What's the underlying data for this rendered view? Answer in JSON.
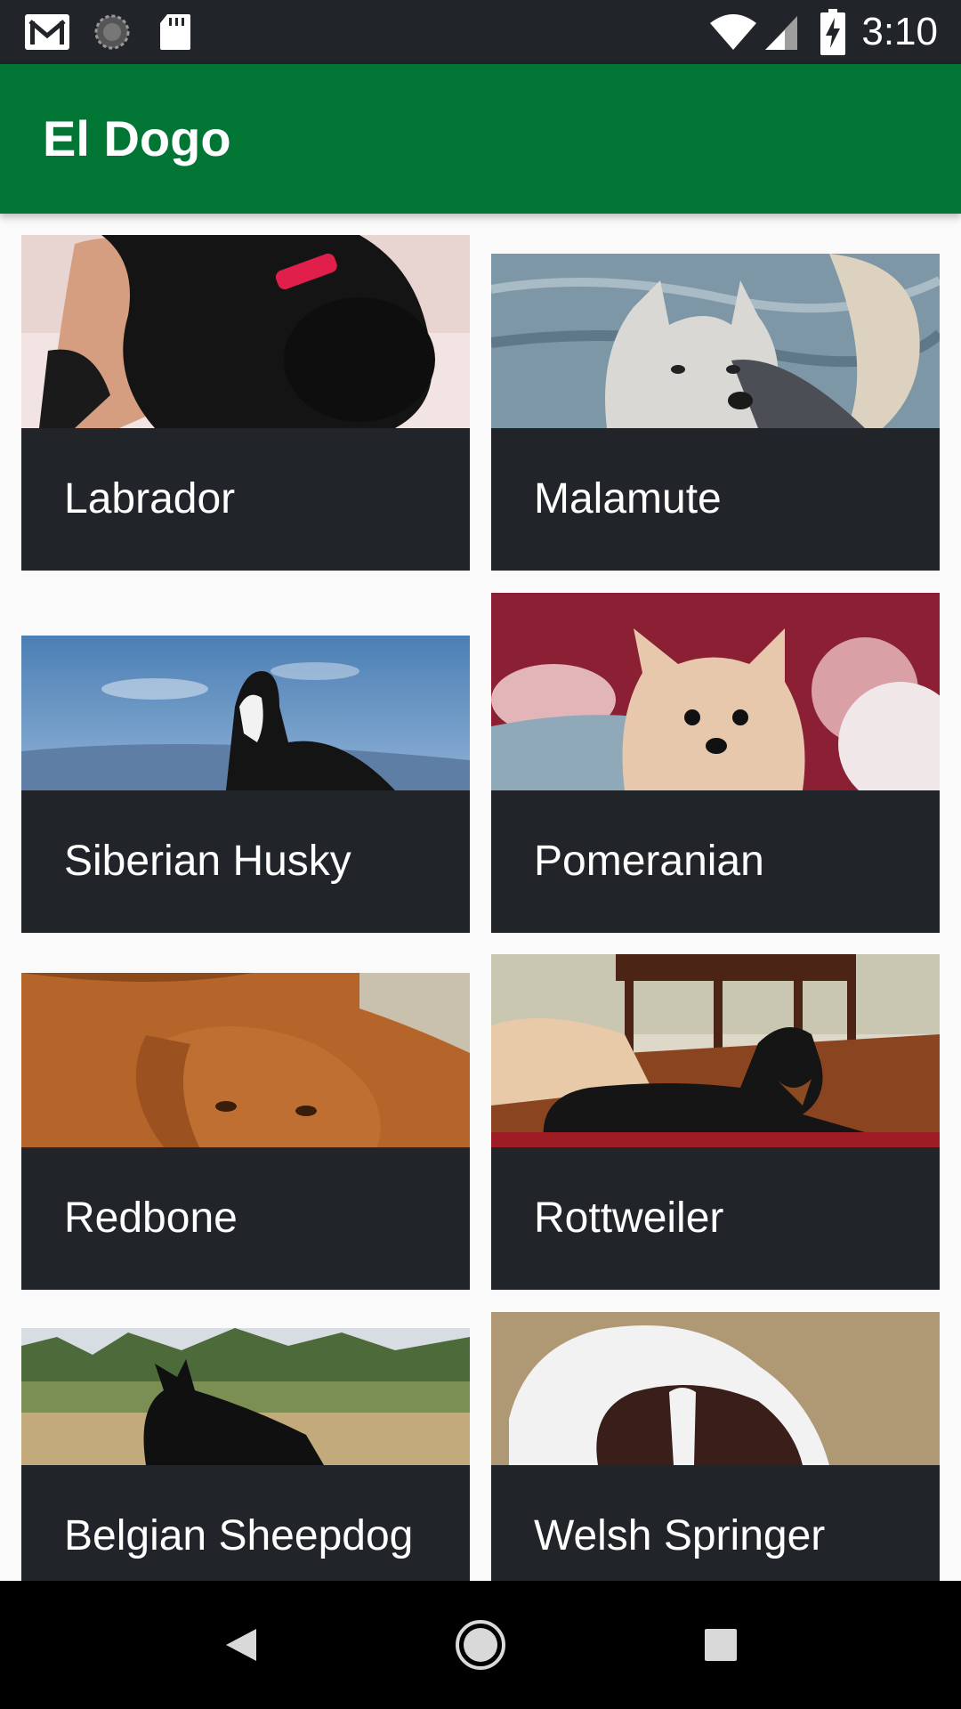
{
  "status_bar": {
    "time": "3:10",
    "icons": [
      "gmail-icon",
      "sync-icon",
      "sd-card-icon",
      "wifi-icon",
      "signal-icon",
      "battery-charging-icon"
    ]
  },
  "app_bar": {
    "title": "El Dogo"
  },
  "breeds": [
    {
      "name": "Labrador"
    },
    {
      "name": "Malamute"
    },
    {
      "name": "Siberian Husky"
    },
    {
      "name": "Pomeranian"
    },
    {
      "name": "Redbone"
    },
    {
      "name": "Rottweiler"
    },
    {
      "name": "Belgian Sheepdog"
    },
    {
      "name": "Welsh Springer"
    }
  ],
  "nav_bar": {
    "buttons": [
      "back-icon",
      "home-icon",
      "recents-icon"
    ]
  },
  "colors": {
    "primary": "#007534",
    "caption_bg": "#212529",
    "background": "#fafafa"
  }
}
